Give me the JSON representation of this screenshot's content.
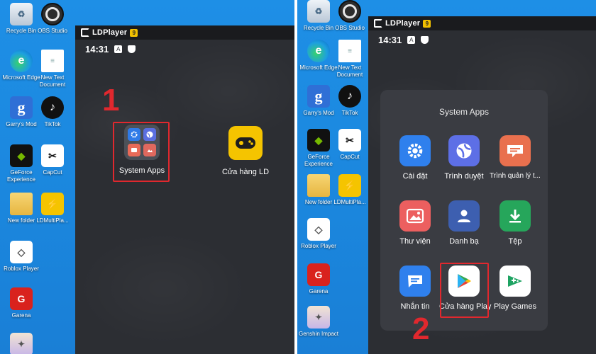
{
  "emulator": {
    "title": "LDPlayer",
    "badge": "9",
    "time": "14:31"
  },
  "steps": {
    "first": "1",
    "second": "2"
  },
  "desktop_left": [
    {
      "name": "recycle-bin-icon",
      "label": "Recycle Bin",
      "glyph": "♻"
    },
    {
      "name": "obs-studio-icon",
      "label": "OBS Studio",
      "glyph": ""
    },
    {
      "name": "edge-icon",
      "label": "Microsoft Edge",
      "glyph": "e"
    },
    {
      "name": "text-document-icon",
      "label": "New Text Document",
      "glyph": "≡"
    },
    {
      "name": "garrys-mod-icon",
      "label": "Garry's Mod",
      "glyph": "g"
    },
    {
      "name": "tiktok-icon",
      "label": "TikTok",
      "glyph": "♪"
    },
    {
      "name": "geforce-icon",
      "label": "GeForce Experience",
      "glyph": "◆"
    },
    {
      "name": "capcut-icon",
      "label": "CapCut",
      "glyph": "✂"
    },
    {
      "name": "folder-icon",
      "label": "New folder",
      "glyph": ""
    },
    {
      "name": "ldmultiplayer-icon",
      "label": "LDMultiPla...",
      "glyph": "⚡"
    },
    {
      "name": "roblox-icon",
      "label": "Roblox Player",
      "glyph": "◇"
    },
    {
      "name": "garena-icon",
      "label": "Garena",
      "glyph": "G"
    },
    {
      "name": "genshin-icon",
      "label": "",
      "glyph": "✦"
    }
  ],
  "desktop_right": [
    {
      "name": "recycle-bin-icon",
      "label": "Recycle Bin",
      "glyph": "♻"
    },
    {
      "name": "obs-studio-icon",
      "label": "OBS Studio",
      "glyph": ""
    },
    {
      "name": "edge-icon",
      "label": "Microsoft Edge",
      "glyph": "e"
    },
    {
      "name": "text-document-icon",
      "label": "New Text Document",
      "glyph": "≡"
    },
    {
      "name": "garrys-mod-icon",
      "label": "Garry's Mod",
      "glyph": "g"
    },
    {
      "name": "tiktok-icon",
      "label": "TikTok",
      "glyph": "♪"
    },
    {
      "name": "geforce-icon",
      "label": "GeForce Experience",
      "glyph": "◆"
    },
    {
      "name": "capcut-icon",
      "label": "CapCut",
      "glyph": "✂"
    },
    {
      "name": "folder-icon",
      "label": "New folder",
      "glyph": ""
    },
    {
      "name": "ldmultiplayer-icon",
      "label": "LDMultiPla...",
      "glyph": "⚡"
    },
    {
      "name": "roblox-icon",
      "label": "Roblox Player",
      "glyph": "◇"
    },
    {
      "name": "garena-icon",
      "label": "Garena",
      "glyph": "G"
    },
    {
      "name": "genshin-icon",
      "label": "Genshin Impact",
      "glyph": "✦"
    }
  ],
  "home": {
    "folder_label": "System Apps",
    "store_label": "Cửa hàng LD"
  },
  "drawer": {
    "title": "System Apps",
    "apps": [
      {
        "name": "settings",
        "label": "Cài đặt"
      },
      {
        "name": "browser",
        "label": "Trình duyệt"
      },
      {
        "name": "document",
        "label": "Trình quản lý t..."
      },
      {
        "name": "gallery",
        "label": "Thư viện"
      },
      {
        "name": "contacts",
        "label": "Danh bạ"
      },
      {
        "name": "files",
        "label": "Tệp"
      },
      {
        "name": "messages",
        "label": "Nhắn tin"
      },
      {
        "name": "play-store",
        "label": "Cửa hàng Play"
      },
      {
        "name": "play-games",
        "label": "Play Games"
      }
    ]
  },
  "colors": {
    "highlight": "#e0282e",
    "desktop": "#1e8fe6",
    "emulator_bg": "#2c2e33"
  }
}
